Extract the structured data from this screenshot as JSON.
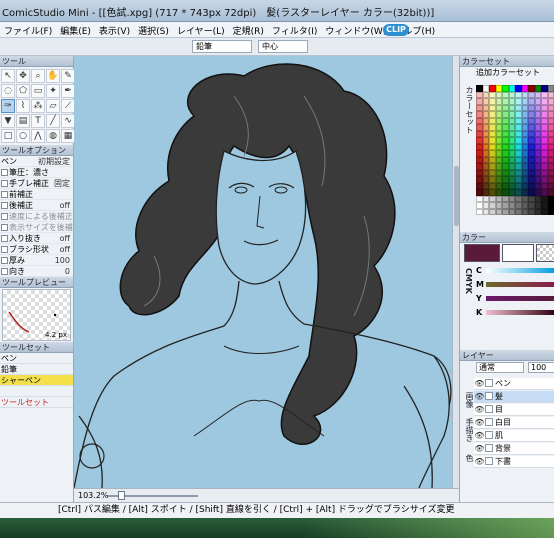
{
  "window": {
    "title": "ComicStudio Mini - [[色試.xpg] (717 * 743px 72dpi)　髪(ラスターレイヤー カラー(32bit))]"
  },
  "menu": {
    "items": [
      "ファイル(F)",
      "編集(E)",
      "表示(V)",
      "選択(S)",
      "レイヤー(L)",
      "定規(R)",
      "フィルタ(I)",
      "ウィンドウ(W)",
      "ヘルプ(H)"
    ],
    "badge": "CLIP"
  },
  "command_bar": {
    "tool_select": "鉛筆",
    "anchor_select": "中心"
  },
  "tool_panel": {
    "header": "ツール",
    "tools": [
      "arrow-icon",
      "move-icon",
      "zoom-icon",
      "hand-icon",
      "eyedropper-icon",
      "lasso-icon",
      "lasso-poly-icon",
      "marquee-icon",
      "magic-wand-icon",
      "select-pen-icon",
      "pen-icon",
      "brush-icon",
      "airbrush-icon",
      "eraser-icon",
      "ruler-icon",
      "fill-icon",
      "gradient-icon",
      "text-icon",
      "line-icon",
      "curve-icon",
      "rect-icon",
      "ellipse-icon",
      "polyline-icon",
      "blur-icon",
      "pattern-icon"
    ],
    "active_index": 10
  },
  "tool_options": {
    "header": "ツールオプション",
    "tabs": [
      "ツールオプション"
    ],
    "reset_label": "初期設定",
    "tab_left": "ペン",
    "rows": [
      {
        "label": "筆圧：濃さ",
        "value": ""
      },
      {
        "label": "手ブレ補正",
        "value": "固定"
      },
      {
        "label": "前補正",
        "value": ""
      },
      {
        "label": "後補正",
        "value": "off"
      },
      {
        "label": "速度による後補正",
        "value": ""
      },
      {
        "label": "表示サイズを後補正に依存",
        "value": ""
      },
      {
        "label": "入り抜き",
        "value": "off"
      },
      {
        "label": "ブラシ形状",
        "value": "off"
      },
      {
        "label": "厚み",
        "value": "100"
      },
      {
        "label": "向き",
        "value": "0"
      }
    ]
  },
  "tool_preview": {
    "header": "ツールプレビュー",
    "size_label": "4.2 px"
  },
  "tool_presets": {
    "header": "ツールセット",
    "items": [
      "ペン",
      "鉛筆",
      "シャーペン",
      "",
      "ツールセット"
    ],
    "highlight_index": 2
  },
  "canvas": {
    "background": "#9ec8df",
    "zoom": "103.2%"
  },
  "color_set_panel": {
    "header": "カラーセット",
    "add_label": "追加カラーセット",
    "side_label": "カラーセット"
  },
  "color_panel": {
    "header": "カラー",
    "side_label": "CMYK",
    "channels": [
      "C",
      "M",
      "Y",
      "K"
    ],
    "main_color": "#5a1a3a"
  },
  "layer_panel": {
    "header": "レイヤー",
    "blend_mode": "通常",
    "opacity": "100",
    "side_label": "画像",
    "side_label2": "手描き",
    "side_label3": "色",
    "layers": [
      {
        "name": "ペン",
        "selected": false
      },
      {
        "name": "髪",
        "selected": true
      },
      {
        "name": "目",
        "selected": false
      },
      {
        "name": "白目",
        "selected": false
      },
      {
        "name": "肌",
        "selected": false
      },
      {
        "name": "背景",
        "selected": false
      },
      {
        "name": "下書",
        "selected": false
      }
    ]
  },
  "status": {
    "message": "[Ctrl] パス編集 / [Alt] スポイト / [Shift] 直線を引く / [Ctrl] + [Alt] ドラッグでブラシサイズ変更"
  }
}
